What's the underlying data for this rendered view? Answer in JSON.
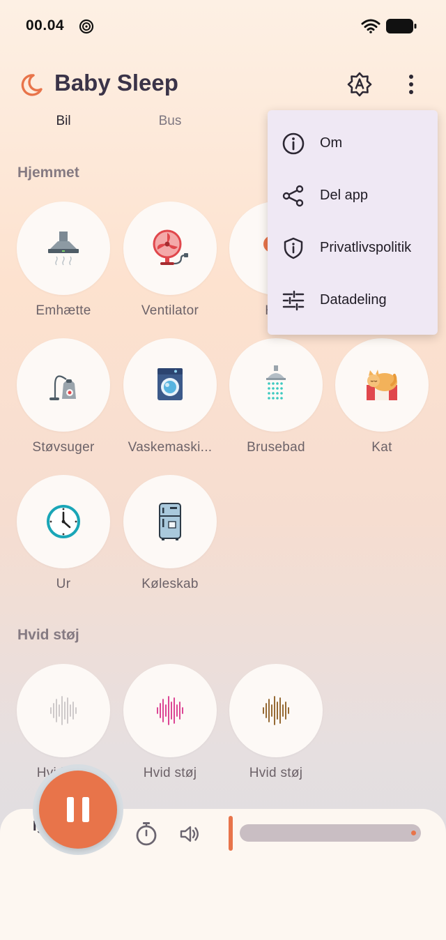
{
  "status_bar": {
    "time": "00.04"
  },
  "app_bar": {
    "title": "Baby Sleep"
  },
  "tabs": [
    {
      "label": "Bil"
    },
    {
      "label": "Bus"
    }
  ],
  "sections": {
    "home": {
      "title": "Hjemmet",
      "items": [
        {
          "label": "Emhætte",
          "icon": "range-hood-icon"
        },
        {
          "label": "Ventilator",
          "icon": "fan-icon"
        },
        {
          "label": "Hår",
          "icon": "hair-dryer-icon"
        },
        {
          "label": "Støvsuger",
          "icon": "vacuum-icon"
        },
        {
          "label": "Vaskemaski...",
          "icon": "washing-machine-icon"
        },
        {
          "label": "Brusebad",
          "icon": "shower-icon"
        },
        {
          "label": "Kat",
          "icon": "cat-icon"
        },
        {
          "label": "Ur",
          "icon": "clock-icon"
        },
        {
          "label": "Køleskab",
          "icon": "fridge-icon"
        }
      ]
    },
    "white_noise": {
      "title": "Hvid støj",
      "items": [
        {
          "label": "Hvid støj",
          "icon": "waveform-white-icon"
        },
        {
          "label": "Hvid støj",
          "icon": "waveform-pink-icon"
        },
        {
          "label": "Hvid støj",
          "icon": "waveform-brown-icon"
        }
      ]
    }
  },
  "menu": {
    "items": [
      {
        "label": "Om",
        "icon": "info-icon"
      },
      {
        "label": "Del app",
        "icon": "share-icon"
      },
      {
        "label": "Privatlivspolitik",
        "icon": "privacy-shield-icon"
      },
      {
        "label": "Datadeling",
        "icon": "sliders-icon"
      }
    ]
  },
  "player": {
    "hidden_label": "Ig",
    "playing": true,
    "volume_level": 0.0
  },
  "colors": {
    "accent": "#e8744a",
    "menu_bg": "#efe8f4",
    "title": "#3a3348"
  }
}
